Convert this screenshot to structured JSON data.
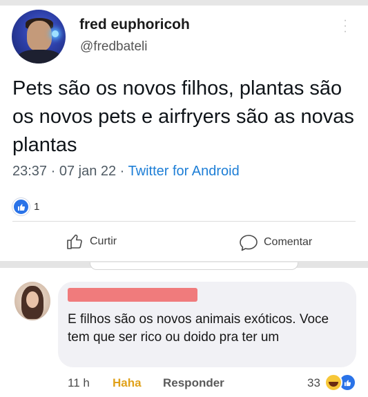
{
  "tweet": {
    "author_name": "fred euphoricoh",
    "author_handle": "@fredbateli",
    "text": "Pets são os novos filhos, plantas são os novos pets e airfryers são as novas plantas",
    "time": "23:37 · 07 jan 22 · ",
    "client": "Twitter for Android"
  },
  "post": {
    "reaction_count": "1",
    "like_label": "Curtir",
    "comment_label": "Comentar"
  },
  "comment": {
    "text": "E filhos são os novos animais exóticos. Voce tem que ser rico ou doido pra ter um",
    "time": "11 h",
    "haha_label": "Haha",
    "reply_label": "Responder",
    "reaction_count": "33"
  },
  "icons": {
    "more": "more-vertical-icon",
    "like": "thumbs-up-icon",
    "comment": "speech-bubble-icon",
    "haha": "haha-emoji-icon"
  },
  "colors": {
    "facebook_blue": "#2a73e8",
    "twitter_link": "#1d7ed6",
    "haha_yellow": "#e0a11a",
    "redaction": "#f06666"
  }
}
